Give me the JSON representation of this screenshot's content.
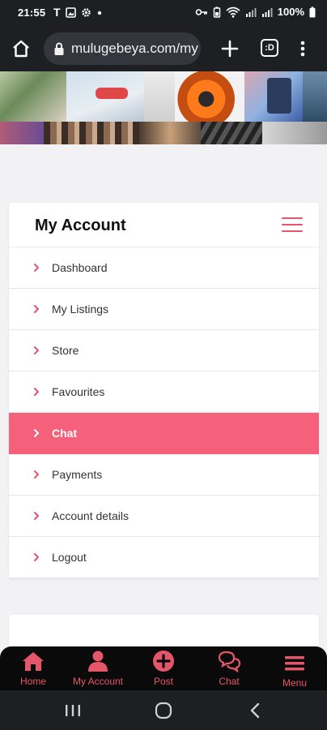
{
  "status_bar": {
    "time": "21:55",
    "battery": "100%",
    "left_icons": [
      "T",
      "gallery-icon",
      "gear-icon",
      "dot-icon"
    ],
    "right_icons": [
      "key-icon",
      "battery-saver-icon",
      "wifi-icon",
      "signal-icon",
      "signal-icon"
    ]
  },
  "browser": {
    "url": "mulugebeya.com/my",
    "tab_count": ":D"
  },
  "account": {
    "title": "My Account",
    "menu": [
      {
        "label": "Dashboard",
        "active": false
      },
      {
        "label": "My Listings",
        "active": false
      },
      {
        "label": "Store",
        "active": false
      },
      {
        "label": "Favourites",
        "active": false
      },
      {
        "label": "Chat",
        "active": true
      },
      {
        "label": "Payments",
        "active": false
      },
      {
        "label": "Account details",
        "active": false
      },
      {
        "label": "Logout",
        "active": false
      }
    ]
  },
  "bottom_nav": [
    {
      "label": "Home",
      "icon": "home-icon"
    },
    {
      "label": "My Account",
      "icon": "user-icon"
    },
    {
      "label": "Post",
      "icon": "plus-circle-icon"
    },
    {
      "label": "Chat",
      "icon": "chat-icon"
    },
    {
      "label": "Menu",
      "icon": "menu-icon"
    }
  ],
  "colors": {
    "accent": "#f5617a",
    "icon_accent": "#e5566a",
    "chrome_dark": "#1e1f23",
    "app_nav_bg": "#0a0a0a",
    "page_bg": "#f2f2f5"
  }
}
